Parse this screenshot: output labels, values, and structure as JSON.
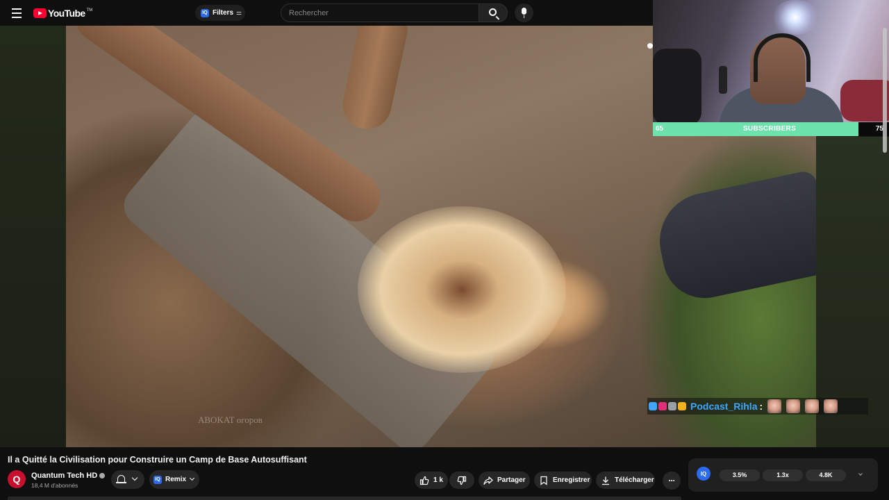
{
  "header": {
    "logo_text": "YouTube",
    "logo_tm": "TM",
    "filters_badge": "IQ",
    "filters_label": "Filters",
    "search_placeholder": "Rechercher"
  },
  "video": {
    "watermark": "ABOKAT огоров"
  },
  "stream_overlay": {
    "sub_current": "65",
    "sub_label": "SUBSCRIBERS",
    "sub_goal": "75",
    "sub_progress": 0.87,
    "chat_name": "Podcast_Rihla",
    "chat_colon": ":",
    "badge_colors": [
      "#3ea6ff",
      "#e0307a",
      "#9aa0a6",
      "#f2b01e"
    ]
  },
  "meta": {
    "title": "Il a Quitté la Civilisation pour Construire un Camp de Base Autosuffisant",
    "channel_initial": "Q",
    "channel_name": "Quantum Tech HD",
    "channel_subs": "18,4 M d'abonnés",
    "remix_badge": "IQ",
    "remix_label": "Remix"
  },
  "actions": {
    "like_count": "1 k",
    "share_label": "Partager",
    "save_label": "Enregistrer",
    "download_label": "Télécharger"
  },
  "stats": {
    "badge": "IQ",
    "values": [
      "3.5%",
      "1.3x",
      "4.8K"
    ]
  },
  "colors": {
    "brand_red": "#ff0033",
    "accent_blue": "#2c6bed",
    "progress_green": "#6ee2ad",
    "chat_name_blue": "#3ea6ff"
  }
}
